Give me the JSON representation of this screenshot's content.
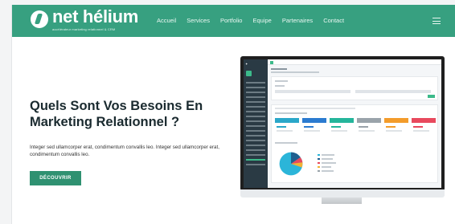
{
  "brand": {
    "name": "net hélium",
    "tagline": "accélérateur marketing relationnel & CRM",
    "primary_color": "#37a080",
    "button_color": "#2f9171"
  },
  "nav": {
    "items": [
      "Accueil",
      "Services",
      "Portfolio",
      "Equipe",
      "Partenaires",
      "Contact"
    ],
    "menu_icon": "hamburger-icon"
  },
  "hero": {
    "headline": "Quels Sont Vos Besoins En Marketing Relationnel ?",
    "paragraph": "Integer sed ullamcorper erat, condimentum convallis leo. Integer sed ullamcorper erat, condimentum convallis leo.",
    "cta_label": "DÉCOUVRIR"
  },
  "illustration": {
    "kind": "monitor showing CRM dashboard",
    "stat_colors": [
      "#2aa7c9",
      "#2b7bd0",
      "#24b59b",
      "#9aa3aa",
      "#f39c2b",
      "#e8495d"
    ],
    "pie_colors": [
      "#2bb5d9",
      "#1f5f8f",
      "#e8495d",
      "#f2b233"
    ]
  }
}
